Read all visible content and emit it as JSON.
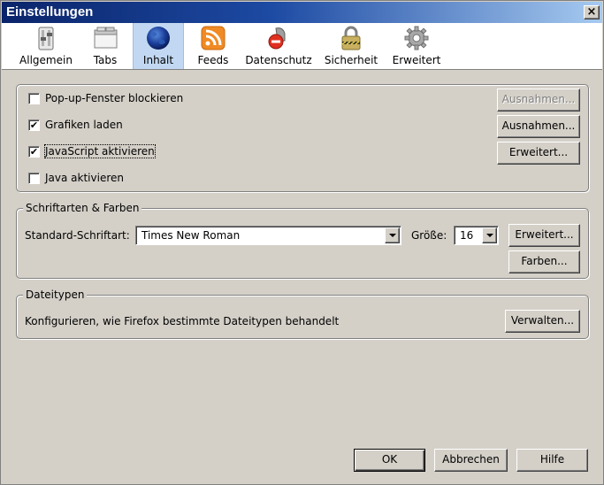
{
  "window": {
    "title": "Einstellungen",
    "close_glyph": "×"
  },
  "tabs": [
    {
      "label": "Allgemein",
      "icon": "switch-panel-icon",
      "selected": false
    },
    {
      "label": "Tabs",
      "icon": "tabs-window-icon",
      "selected": false
    },
    {
      "label": "Inhalt",
      "icon": "globe-icon",
      "selected": true
    },
    {
      "label": "Feeds",
      "icon": "rss-feed-icon",
      "selected": false
    },
    {
      "label": "Datenschutz",
      "icon": "no-entry-mask-icon",
      "selected": false
    },
    {
      "label": "Sicherheit",
      "icon": "padlock-icon",
      "selected": false
    },
    {
      "label": "Erweitert",
      "icon": "gear-icon",
      "selected": false
    }
  ],
  "content": {
    "popup": {
      "label": "Pop-up-Fenster blockieren",
      "checked": false,
      "button": "Ausnahmen...",
      "button_disabled": true
    },
    "images": {
      "label": "Grafiken laden",
      "checked": true,
      "button": "Ausnahmen..."
    },
    "javascript": {
      "label": "JavaScript aktivieren",
      "checked": true,
      "button": "Erweitert..."
    },
    "java": {
      "label": "Java aktivieren",
      "checked": false
    }
  },
  "fonts": {
    "legend": "Schriftarten & Farben",
    "default_font_label": "Standard-Schriftart:",
    "default_font_value": "Times New Roman",
    "size_label": "Größe:",
    "size_value": "16",
    "advanced_button": "Erweitert...",
    "colors_button": "Farben..."
  },
  "filetypes": {
    "legend": "Dateitypen",
    "description": "Konfigurieren, wie Firefox bestimmte Dateitypen behandelt",
    "manage_button": "Verwalten..."
  },
  "footer": {
    "ok": "OK",
    "cancel": "Abbrechen",
    "help": "Hilfe"
  },
  "check_glyph": "✔",
  "colors": {
    "titlebar_start": "#0a246a",
    "titlebar_end": "#a6caf0",
    "dialog_bg": "#d4d0c8",
    "selected_tab": "#c2d8f2"
  }
}
